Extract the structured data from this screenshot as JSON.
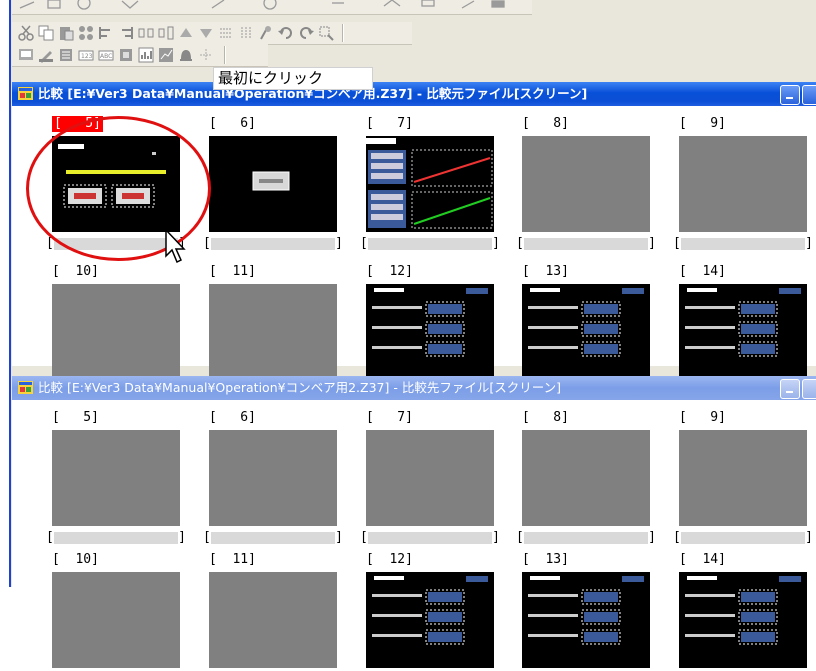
{
  "callout": {
    "text": "最初にクリック"
  },
  "toolbars": {
    "row1": {
      "icons": [
        "pen-icon",
        "rect-icon",
        "circle-icon",
        "text-icon",
        "polyline-icon",
        "fill-icon",
        "pointer-icon",
        "arc-icon",
        "parts-icon",
        "arrow-icon",
        "flag-icon"
      ]
    },
    "row2": {
      "icons": [
        "cut-icon",
        "copy-icon",
        "paste-icon",
        "group-icon",
        "align-left-icon",
        "align-right-icon",
        "dist-h-icon",
        "dist-v-icon",
        "layer-up-icon",
        "layer-down-icon",
        "grid-icon",
        "grid2-icon",
        "paint-icon",
        "undo-icon",
        "redo-icon",
        "select-icon"
      ]
    },
    "row3": {
      "icons": [
        "screen-icon",
        "edit-icon",
        "compare-icon",
        "field-icon",
        "abc-icon",
        "numeric-icon",
        "graph-icon",
        "chart-icon",
        "alarm-icon",
        "network-icon"
      ]
    }
  },
  "window_source": {
    "title": "比較 [E:¥Ver3 Data¥Manual¥Operation¥コンベア用.Z37] - 比較元ファイル[スクリーン]",
    "screens_row1": [
      {
        "label": "[   5]",
        "selected": true,
        "thumb": "black-title-switches"
      },
      {
        "label": "[   6]",
        "selected": false,
        "thumb": "black-button"
      },
      {
        "label": "[   7]",
        "selected": false,
        "thumb": "black-graphs"
      },
      {
        "label": "[   8]",
        "selected": false,
        "thumb": "gray"
      },
      {
        "label": "[   9]",
        "selected": false,
        "thumb": "gray"
      }
    ],
    "screens_row2": [
      {
        "label": "[  10]",
        "thumb": "gray"
      },
      {
        "label": "[  11]",
        "thumb": "gray"
      },
      {
        "label": "[  12]",
        "thumb": "black-form"
      },
      {
        "label": "[  13]",
        "thumb": "black-form"
      },
      {
        "label": "[  14]",
        "thumb": "black-form"
      }
    ]
  },
  "window_target": {
    "title": "比較 [E:¥Ver3 Data¥Manual¥Operation¥コンベア用2.Z37] - 比較先ファイル[スクリーン]",
    "screens_row1": [
      {
        "label": "[   5]",
        "thumb": "gray"
      },
      {
        "label": "[   6]",
        "thumb": "gray"
      },
      {
        "label": "[   7]",
        "thumb": "gray"
      },
      {
        "label": "[   8]",
        "thumb": "gray"
      },
      {
        "label": "[   9]",
        "thumb": "gray"
      }
    ],
    "screens_row2": [
      {
        "label": "[  10]",
        "thumb": "gray"
      },
      {
        "label": "[  11]",
        "thumb": "gray"
      },
      {
        "label": "[  12]",
        "thumb": "black-form"
      },
      {
        "label": "[  13]",
        "thumb": "black-form"
      },
      {
        "label": "[  14]",
        "thumb": "black-form"
      }
    ]
  },
  "colors": {
    "title_active": "#0a4fd6",
    "title_inactive": "#86a5e9",
    "selected_label": "#ff0000",
    "highlight_circle": "#e01010"
  }
}
